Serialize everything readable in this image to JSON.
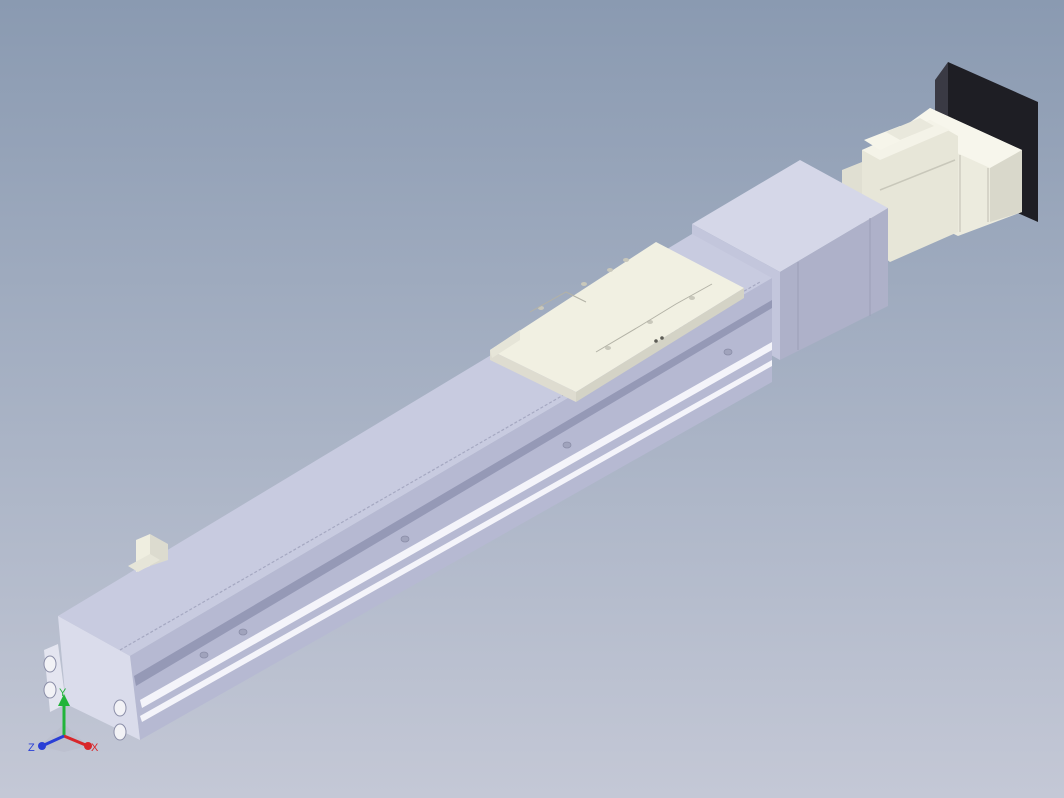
{
  "viewport": {
    "background_top": "#8a9ab1",
    "background_bottom": "#c4c8d6"
  },
  "model": {
    "description_icon": "linear-actuator-model",
    "body_color": "#c9ccdf",
    "carriage_color": "#f1f0e2",
    "motor_color": "#efefe2",
    "flange_color": "#1e1e24"
  },
  "triad": {
    "x_label": "X",
    "y_label": "Y",
    "z_label": "Z",
    "x_color": "#d8262a",
    "y_color": "#22b43a",
    "z_color": "#2a3fd6"
  }
}
